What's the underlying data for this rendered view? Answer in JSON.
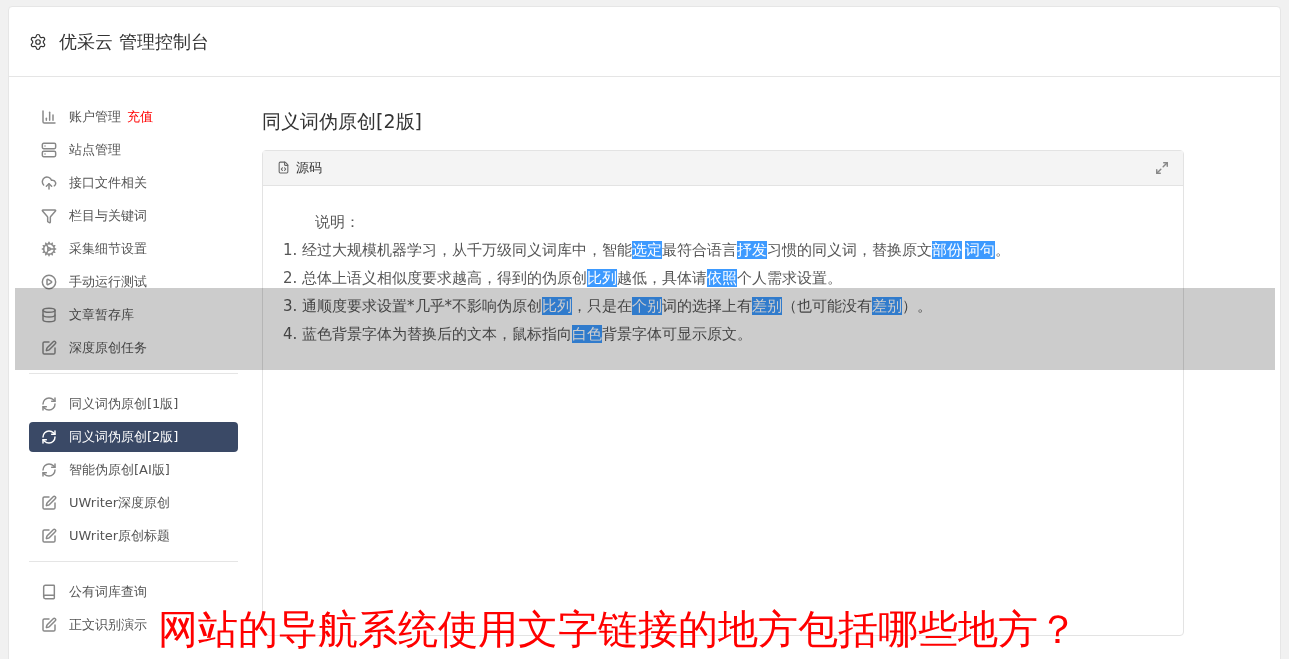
{
  "header": {
    "title": "优采云 管理控制台"
  },
  "sidebar": {
    "groups": [
      [
        {
          "label": "账户管理",
          "badge": "充值",
          "selected": false
        },
        {
          "label": "站点管理",
          "selected": false
        },
        {
          "label": "接口文件相关",
          "selected": false
        },
        {
          "label": "栏目与关键词",
          "selected": false
        },
        {
          "label": "采集细节设置",
          "selected": false
        },
        {
          "label": "手动运行测试",
          "selected": false
        },
        {
          "label": "文章暂存库",
          "selected": false
        },
        {
          "label": "深度原创任务",
          "selected": false
        }
      ],
      [
        {
          "label": "同义词伪原创[1版]",
          "selected": false
        },
        {
          "label": "同义词伪原创[2版]",
          "selected": true
        },
        {
          "label": "智能伪原创[AI版]",
          "selected": false
        },
        {
          "label": "UWriter深度原创",
          "selected": false
        },
        {
          "label": "UWriter原创标题",
          "selected": false
        }
      ],
      [
        {
          "label": "公有词库查询",
          "selected": false
        },
        {
          "label": "正文识别演示",
          "selected": false
        }
      ]
    ]
  },
  "content": {
    "title": "同义词伪原创[2版]",
    "panel": {
      "tab": "源码",
      "heading": "说明：",
      "lines": [
        [
          {
            "text": "1. 经过大规模机器学习，从千万级同义词库中，智能",
            "replaced": false
          },
          {
            "text": "选定",
            "replaced": true
          },
          {
            "text": "最符合语言",
            "replaced": false
          },
          {
            "text": "抒发",
            "replaced": true
          },
          {
            "text": "习惯的同义词，替换原文",
            "replaced": false
          },
          {
            "text": "部份",
            "replaced": true
          },
          {
            "text": "词句",
            "replaced": true
          },
          {
            "text": "。",
            "replaced": false
          }
        ],
        [
          {
            "text": "2. 总体上语义相似度要求越高，得到的伪原创",
            "replaced": false
          },
          {
            "text": "比列",
            "replaced": true
          },
          {
            "text": "越低，具体请",
            "replaced": false
          },
          {
            "text": "依照",
            "replaced": true
          },
          {
            "text": "个人需求设置。",
            "replaced": false
          }
        ],
        [
          {
            "text": "3. 通顺度要求设置*几乎*不影响伪原创",
            "replaced": false
          },
          {
            "text": "比列",
            "replaced": true
          },
          {
            "text": "，只是在",
            "replaced": false
          },
          {
            "text": "个别",
            "replaced": true
          },
          {
            "text": "词的选择上有",
            "replaced": false
          },
          {
            "text": "差别",
            "replaced": true
          },
          {
            "text": "（也可能没有",
            "replaced": false
          },
          {
            "text": "差别",
            "replaced": true
          },
          {
            "text": "）。",
            "replaced": false
          }
        ],
        [
          {
            "text": "4. 蓝色背景字体为替换后的文本，鼠标指向",
            "replaced": false
          },
          {
            "text": "白色",
            "replaced": true
          },
          {
            "text": "背景字体可显示原文。",
            "replaced": false
          }
        ]
      ]
    }
  },
  "caption": "网站的导航系统使用文字链接的地方包括哪些地方？"
}
